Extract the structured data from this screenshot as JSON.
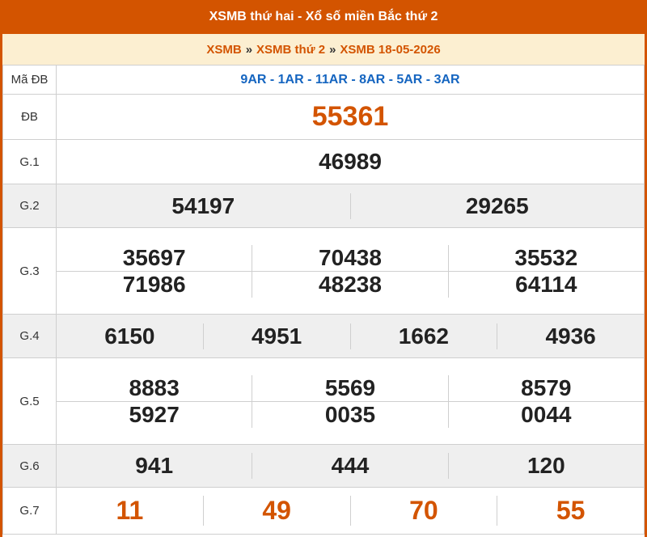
{
  "header": {
    "title": "XSMB thứ hai - Xổ số miền Bắc thứ 2"
  },
  "breadcrumb": {
    "items": [
      "XSMB",
      "XSMB thứ 2",
      "XSMB 18-05-2026"
    ],
    "separator": "»"
  },
  "labels": {
    "ma_db": "Mã ĐB",
    "db": "ĐB",
    "g1": "G.1",
    "g2": "G.2",
    "g3": "G.3",
    "g4": "G.4",
    "g5": "G.5",
    "g6": "G.6",
    "g7": "G.7"
  },
  "results": {
    "ma_db": "9AR - 1AR - 11AR - 8AR - 5AR - 3AR",
    "db": "55361",
    "g1": "46989",
    "g2": [
      "54197",
      "29265"
    ],
    "g3": [
      "35697",
      "70438",
      "35532",
      "71986",
      "48238",
      "64114"
    ],
    "g4": [
      "6150",
      "4951",
      "1662",
      "4936"
    ],
    "g5": [
      "8883",
      "5569",
      "8579",
      "5927",
      "0035",
      "0044"
    ],
    "g6": [
      "941",
      "444",
      "120"
    ],
    "g7": [
      "11",
      "49",
      "70",
      "55"
    ]
  },
  "colors": {
    "accent": "#d35400",
    "crumb_bg": "#fcefd1",
    "code_blue": "#1565c0",
    "row_gray": "#efefef"
  }
}
